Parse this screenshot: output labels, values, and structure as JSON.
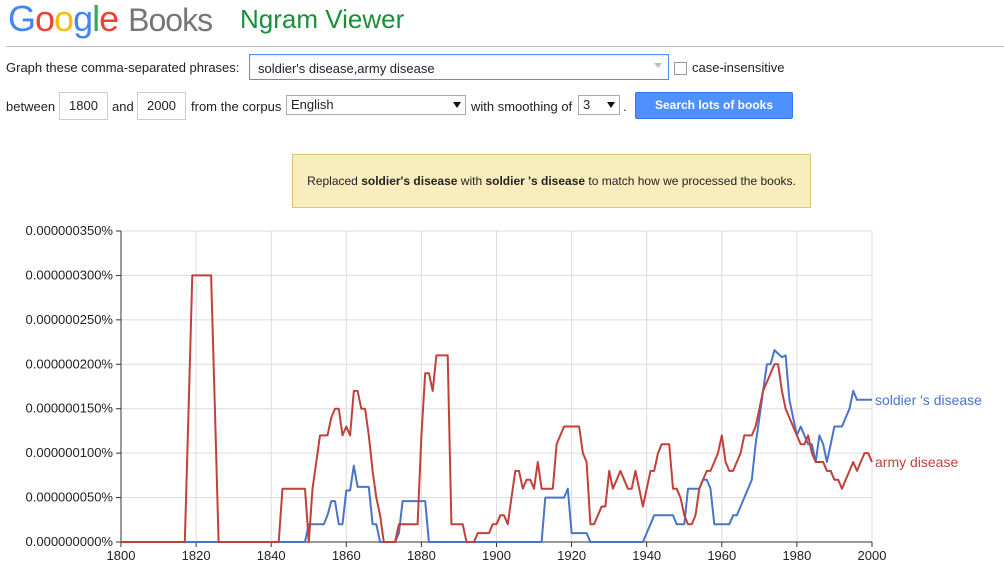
{
  "header": {
    "logo_letters": [
      "G",
      "o",
      "o",
      "g",
      "l",
      "e"
    ],
    "logo_books": "Books",
    "title": "Ngram Viewer"
  },
  "form": {
    "phrases_label": "Graph these comma-separated phrases:",
    "phrases_value": "soldier's disease,army disease",
    "case_insensitive_label": "case-insensitive",
    "case_insensitive_checked": false,
    "between_label": "between",
    "start_year": "1800",
    "and_label": "and",
    "end_year": "2000",
    "corpus_label": "from the corpus",
    "corpus_value": "English",
    "smoothing_label": "with smoothing of",
    "smoothing_value": "3",
    "smoothing_suffix": ".",
    "search_button": "Search lots of books"
  },
  "notice": {
    "prefix": "Replaced ",
    "original": "soldier's disease",
    "middle": " with ",
    "replacement": "soldier 's disease",
    "suffix": " to match how we processed the books."
  },
  "chart_data": {
    "type": "line",
    "xlim": [
      1800,
      2000
    ],
    "ylim": [
      0,
      3.5e-09
    ],
    "y_ticks": [
      "0.000000000%",
      "0.000000050%",
      "0.000000100%",
      "0.000000150%",
      "0.000000200%",
      "0.000000250%",
      "0.000000300%",
      "0.000000350%"
    ],
    "x_ticks": [
      "1800",
      "1820",
      "1840",
      "1860",
      "1880",
      "1900",
      "1920",
      "1940",
      "1960",
      "1980",
      "2000"
    ],
    "grid": true,
    "series": [
      {
        "name": "soldier 's disease",
        "color": "#4a74c9",
        "points": [
          [
            1800,
            0
          ],
          [
            1849,
            0
          ],
          [
            1850,
            2e-10
          ],
          [
            1851,
            2e-10
          ],
          [
            1852,
            2e-10
          ],
          [
            1853,
            2e-10
          ],
          [
            1854,
            2e-10
          ],
          [
            1855,
            3e-10
          ],
          [
            1856,
            4.6e-10
          ],
          [
            1857,
            4.6e-10
          ],
          [
            1858,
            2e-10
          ],
          [
            1859,
            2e-10
          ],
          [
            1860,
            5.8e-10
          ],
          [
            1861,
            5.8e-10
          ],
          [
            1862,
            8.6e-10
          ],
          [
            1863,
            6.2e-10
          ],
          [
            1864,
            6.2e-10
          ],
          [
            1865,
            6.2e-10
          ],
          [
            1866,
            6.2e-10
          ],
          [
            1867,
            2e-10
          ],
          [
            1868,
            2e-10
          ],
          [
            1869,
            0
          ],
          [
            1873,
            0
          ],
          [
            1874,
            1e-10
          ],
          [
            1875,
            4.6e-10
          ],
          [
            1876,
            4.6e-10
          ],
          [
            1877,
            4.6e-10
          ],
          [
            1878,
            4.6e-10
          ],
          [
            1879,
            4.6e-10
          ],
          [
            1880,
            4.6e-10
          ],
          [
            1881,
            4.6e-10
          ],
          [
            1882,
            0
          ],
          [
            1912,
            0
          ],
          [
            1913,
            5e-10
          ],
          [
            1914,
            5e-10
          ],
          [
            1915,
            5e-10
          ],
          [
            1916,
            5e-10
          ],
          [
            1917,
            5e-10
          ],
          [
            1918,
            5e-10
          ],
          [
            1919,
            6e-10
          ],
          [
            1920,
            1e-10
          ],
          [
            1921,
            1e-10
          ],
          [
            1922,
            1e-10
          ],
          [
            1923,
            1e-10
          ],
          [
            1924,
            1e-10
          ],
          [
            1925,
            0
          ],
          [
            1939,
            0
          ],
          [
            1940,
            1e-10
          ],
          [
            1941,
            2e-10
          ],
          [
            1942,
            3e-10
          ],
          [
            1943,
            3e-10
          ],
          [
            1944,
            3e-10
          ],
          [
            1945,
            3e-10
          ],
          [
            1946,
            3e-10
          ],
          [
            1947,
            3e-10
          ],
          [
            1948,
            2e-10
          ],
          [
            1949,
            2e-10
          ],
          [
            1950,
            2e-10
          ],
          [
            1951,
            6e-10
          ],
          [
            1952,
            6e-10
          ],
          [
            1953,
            6e-10
          ],
          [
            1954,
            6e-10
          ],
          [
            1955,
            7e-10
          ],
          [
            1956,
            7e-10
          ],
          [
            1957,
            6e-10
          ],
          [
            1958,
            2e-10
          ],
          [
            1959,
            2e-10
          ],
          [
            1960,
            2e-10
          ],
          [
            1961,
            2e-10
          ],
          [
            1962,
            2e-10
          ],
          [
            1963,
            3e-10
          ],
          [
            1964,
            3e-10
          ],
          [
            1965,
            4e-10
          ],
          [
            1966,
            5e-10
          ],
          [
            1967,
            6e-10
          ],
          [
            1968,
            7e-10
          ],
          [
            1969,
            1.1e-09
          ],
          [
            1970,
            1.4e-09
          ],
          [
            1971,
            1.7e-09
          ],
          [
            1972,
            2e-09
          ],
          [
            1973,
            2e-09
          ],
          [
            1974,
            2.16e-09
          ],
          [
            1975,
            2.12e-09
          ],
          [
            1976,
            2.08e-09
          ],
          [
            1977,
            2.1e-09
          ],
          [
            1978,
            1.6e-09
          ],
          [
            1979,
            1.4e-09
          ],
          [
            1980,
            1.2e-09
          ],
          [
            1981,
            1.3e-09
          ],
          [
            1982,
            1.2e-09
          ],
          [
            1983,
            1.1e-09
          ],
          [
            1984,
            1.1e-09
          ],
          [
            1985,
            9e-10
          ],
          [
            1986,
            1.2e-09
          ],
          [
            1987,
            1.1e-09
          ],
          [
            1988,
            9e-10
          ],
          [
            1989,
            1.1e-09
          ],
          [
            1990,
            1.3e-09
          ],
          [
            1991,
            1.3e-09
          ],
          [
            1992,
            1.3e-09
          ],
          [
            1993,
            1.4e-09
          ],
          [
            1994,
            1.5e-09
          ],
          [
            1995,
            1.7e-09
          ],
          [
            1996,
            1.6e-09
          ],
          [
            1997,
            1.6e-09
          ],
          [
            1998,
            1.6e-09
          ],
          [
            1999,
            1.6e-09
          ],
          [
            2000,
            1.6e-09
          ]
        ]
      },
      {
        "name": "army disease",
        "color": "#c2403a",
        "points": [
          [
            1800,
            0
          ],
          [
            1817,
            0
          ],
          [
            1818,
            1.5e-09
          ],
          [
            1819,
            3e-09
          ],
          [
            1820,
            3e-09
          ],
          [
            1821,
            3e-09
          ],
          [
            1822,
            3e-09
          ],
          [
            1823,
            3e-09
          ],
          [
            1824,
            3e-09
          ],
          [
            1825,
            1.5e-09
          ],
          [
            1826,
            0
          ],
          [
            1842,
            0
          ],
          [
            1843,
            6e-10
          ],
          [
            1844,
            6e-10
          ],
          [
            1845,
            6e-10
          ],
          [
            1846,
            6e-10
          ],
          [
            1847,
            6e-10
          ],
          [
            1848,
            6e-10
          ],
          [
            1849,
            6e-10
          ],
          [
            1850,
            0
          ],
          [
            1851,
            6e-10
          ],
          [
            1852,
            9e-10
          ],
          [
            1853,
            1.2e-09
          ],
          [
            1854,
            1.2e-09
          ],
          [
            1855,
            1.2e-09
          ],
          [
            1856,
            1.4e-09
          ],
          [
            1857,
            1.5e-09
          ],
          [
            1858,
            1.5e-09
          ],
          [
            1859,
            1.2e-09
          ],
          [
            1860,
            1.3e-09
          ],
          [
            1861,
            1.2e-09
          ],
          [
            1862,
            1.7e-09
          ],
          [
            1863,
            1.7e-09
          ],
          [
            1864,
            1.5e-09
          ],
          [
            1865,
            1.5e-09
          ],
          [
            1866,
            1.2e-09
          ],
          [
            1867,
            8e-10
          ],
          [
            1868,
            5e-10
          ],
          [
            1869,
            3e-10
          ],
          [
            1870,
            0
          ],
          [
            1873,
            0
          ],
          [
            1874,
            2e-10
          ],
          [
            1875,
            2e-10
          ],
          [
            1876,
            2e-10
          ],
          [
            1877,
            2e-10
          ],
          [
            1878,
            2e-10
          ],
          [
            1879,
            2e-10
          ],
          [
            1880,
            1.2e-09
          ],
          [
            1881,
            1.9e-09
          ],
          [
            1882,
            1.9e-09
          ],
          [
            1883,
            1.7e-09
          ],
          [
            1884,
            2.1e-09
          ],
          [
            1885,
            2.1e-09
          ],
          [
            1886,
            2.1e-09
          ],
          [
            1887,
            2.1e-09
          ],
          [
            1888,
            2e-10
          ],
          [
            1889,
            2e-10
          ],
          [
            1890,
            2e-10
          ],
          [
            1891,
            2e-10
          ],
          [
            1892,
            0
          ],
          [
            1894,
            0
          ],
          [
            1895,
            1e-10
          ],
          [
            1896,
            1e-10
          ],
          [
            1897,
            1e-10
          ],
          [
            1898,
            1e-10
          ],
          [
            1899,
            2e-10
          ],
          [
            1900,
            2e-10
          ],
          [
            1901,
            3e-10
          ],
          [
            1902,
            3e-10
          ],
          [
            1903,
            2e-10
          ],
          [
            1904,
            5e-10
          ],
          [
            1905,
            8e-10
          ],
          [
            1906,
            8e-10
          ],
          [
            1907,
            6e-10
          ],
          [
            1908,
            7e-10
          ],
          [
            1909,
            7e-10
          ],
          [
            1910,
            6e-10
          ],
          [
            1911,
            9e-10
          ],
          [
            1912,
            6e-10
          ],
          [
            1913,
            6e-10
          ],
          [
            1914,
            6e-10
          ],
          [
            1915,
            6e-10
          ],
          [
            1916,
            1.1e-09
          ],
          [
            1917,
            1.2e-09
          ],
          [
            1918,
            1.3e-09
          ],
          [
            1919,
            1.3e-09
          ],
          [
            1920,
            1.3e-09
          ],
          [
            1921,
            1.3e-09
          ],
          [
            1922,
            1.3e-09
          ],
          [
            1923,
            1e-09
          ],
          [
            1924,
            9e-10
          ],
          [
            1925,
            2e-10
          ],
          [
            1926,
            2e-10
          ],
          [
            1927,
            3e-10
          ],
          [
            1928,
            4e-10
          ],
          [
            1929,
            4e-10
          ],
          [
            1930,
            8e-10
          ],
          [
            1931,
            6e-10
          ],
          [
            1932,
            7e-10
          ],
          [
            1933,
            8e-10
          ],
          [
            1934,
            7e-10
          ],
          [
            1935,
            6e-10
          ],
          [
            1936,
            6e-10
          ],
          [
            1937,
            8e-10
          ],
          [
            1938,
            6e-10
          ],
          [
            1939,
            4e-10
          ],
          [
            1940,
            6e-10
          ],
          [
            1941,
            8e-10
          ],
          [
            1942,
            8e-10
          ],
          [
            1943,
            1e-09
          ],
          [
            1944,
            1.1e-09
          ],
          [
            1945,
            1.1e-09
          ],
          [
            1946,
            1.1e-09
          ],
          [
            1947,
            6e-10
          ],
          [
            1948,
            6e-10
          ],
          [
            1949,
            5e-10
          ],
          [
            1950,
            3e-10
          ],
          [
            1951,
            2e-10
          ],
          [
            1952,
            2e-10
          ],
          [
            1953,
            3e-10
          ],
          [
            1954,
            6e-10
          ],
          [
            1955,
            7e-10
          ],
          [
            1956,
            8e-10
          ],
          [
            1957,
            8e-10
          ],
          [
            1958,
            9e-10
          ],
          [
            1959,
            1e-09
          ],
          [
            1960,
            1.2e-09
          ],
          [
            1961,
            9e-10
          ],
          [
            1962,
            8e-10
          ],
          [
            1963,
            8e-10
          ],
          [
            1964,
            9e-10
          ],
          [
            1965,
            1e-09
          ],
          [
            1966,
            1.2e-09
          ],
          [
            1967,
            1.2e-09
          ],
          [
            1968,
            1.2e-09
          ],
          [
            1969,
            1.3e-09
          ],
          [
            1970,
            1.5e-09
          ],
          [
            1971,
            1.7e-09
          ],
          [
            1972,
            1.8e-09
          ],
          [
            1973,
            1.9e-09
          ],
          [
            1974,
            2e-09
          ],
          [
            1975,
            2e-09
          ],
          [
            1976,
            1.7e-09
          ],
          [
            1977,
            1.5e-09
          ],
          [
            1978,
            1.4e-09
          ],
          [
            1979,
            1.3e-09
          ],
          [
            1980,
            1.2e-09
          ],
          [
            1981,
            1.1e-09
          ],
          [
            1982,
            1.1e-09
          ],
          [
            1983,
            1.2e-09
          ],
          [
            1984,
            1e-09
          ],
          [
            1985,
            9e-10
          ],
          [
            1986,
            9e-10
          ],
          [
            1987,
            9e-10
          ],
          [
            1988,
            8e-10
          ],
          [
            1989,
            8e-10
          ],
          [
            1990,
            7e-10
          ],
          [
            1991,
            7e-10
          ],
          [
            1992,
            6e-10
          ],
          [
            1993,
            7e-10
          ],
          [
            1994,
            8e-10
          ],
          [
            1995,
            9e-10
          ],
          [
            1996,
            8e-10
          ],
          [
            1997,
            9e-10
          ],
          [
            1998,
            1e-09
          ],
          [
            1999,
            1e-09
          ],
          [
            2000,
            9e-10
          ]
        ]
      }
    ]
  }
}
